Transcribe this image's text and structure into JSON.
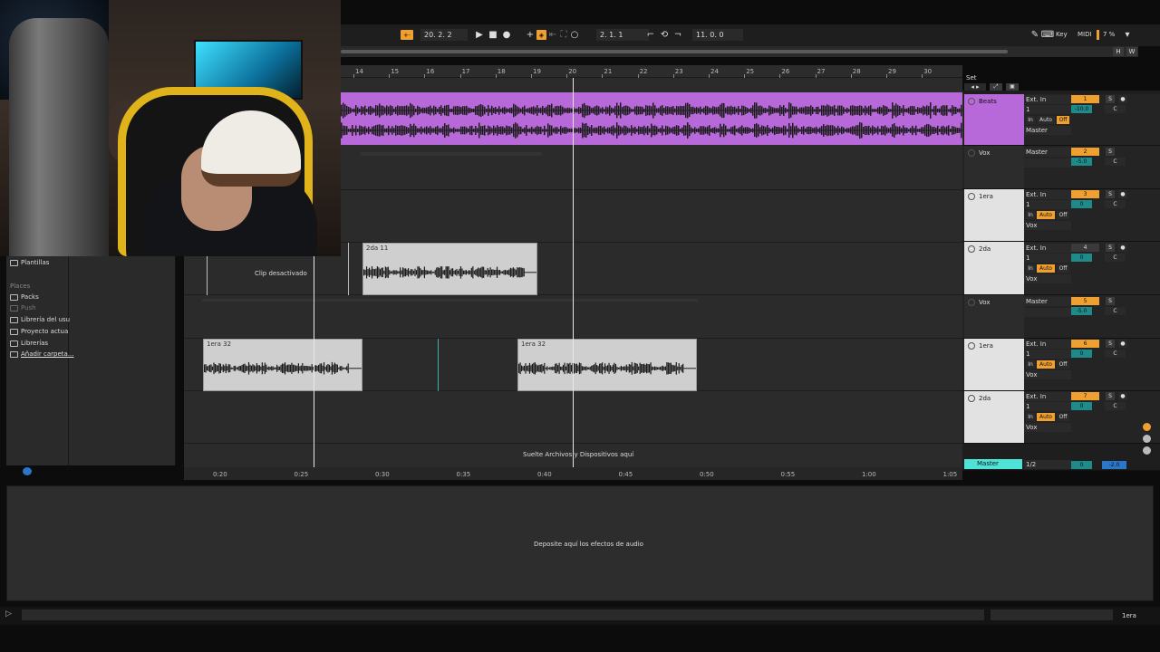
{
  "transport": {
    "tempo_btn": "+·",
    "position": "20.  2.  2",
    "loop_start": "2.  1.  1",
    "loop_length": "11.  0.  0",
    "key_label": "Key",
    "midi_label": "MIDI",
    "cpu": "7 %",
    "h_label": "H",
    "w_label": "W"
  },
  "ruler": {
    "bars": [
      "14",
      "15",
      "16",
      "17",
      "18",
      "19",
      "20",
      "21",
      "22",
      "23",
      "24",
      "25",
      "26",
      "27",
      "28",
      "29",
      "30"
    ]
  },
  "timebar": {
    "times": [
      "0:20",
      "0:25",
      "0:30",
      "0:35",
      "0:40",
      "0:45",
      "0:50",
      "0:55",
      "1:00",
      "1:05"
    ]
  },
  "arrangement": {
    "clip_disabled": "Clip desactivado",
    "clip_2da": "2da 11",
    "clip_1era_a": "1era 32",
    "clip_1era_b": "1era 32",
    "drop_text": "Suelte Archivos y Dispositivos aquí"
  },
  "set_label": "Set",
  "tracks": [
    {
      "name": "Beats",
      "in": "Ext. In",
      "ch": "1",
      "monitor": [
        "In",
        "Auto",
        "Off"
      ],
      "out": "Master",
      "num": "1",
      "vol": "-10.0",
      "pan": "C"
    },
    {
      "name": "Vox",
      "out": "Master",
      "num": "2",
      "vol": "-5.0",
      "pan": "C"
    },
    {
      "name": "1era",
      "in": "Ext. In",
      "ch": "1",
      "monitor": [
        "In",
        "Auto",
        "Off"
      ],
      "out": "Vox",
      "num": "3",
      "vol": "0",
      "pan": "C"
    },
    {
      "name": "2da",
      "in": "Ext. In",
      "ch": "1",
      "monitor": [
        "In",
        "Auto",
        "Off"
      ],
      "out": "Vox",
      "num": "4",
      "vol": "0",
      "pan": "C"
    },
    {
      "name": "Vox",
      "out": "Master",
      "num": "5",
      "vol": "-5.0",
      "pan": "C"
    },
    {
      "name": "1era",
      "in": "Ext. In",
      "ch": "1",
      "monitor": [
        "In",
        "Auto",
        "Off"
      ],
      "out": "Vox",
      "num": "6",
      "vol": "0",
      "pan": "C"
    },
    {
      "name": "2da",
      "in": "Ext. In",
      "ch": "1",
      "monitor": [
        "In",
        "Auto",
        "Off"
      ],
      "out": "Vox",
      "num": "7",
      "vol": "0",
      "pan": "C"
    }
  ],
  "master": {
    "name": "Master",
    "out": "1/2",
    "vol": "0",
    "vol2": "-2.0"
  },
  "browser": {
    "templates": "Plantillas",
    "places_heading": "Places",
    "places": [
      "Packs",
      "Push",
      "Librería del usu",
      "Proyecto actua",
      "Librerías",
      "Añadir carpeta..."
    ]
  },
  "device_drop": "Deposite aquí los efectos de audio",
  "status_track": "1era"
}
